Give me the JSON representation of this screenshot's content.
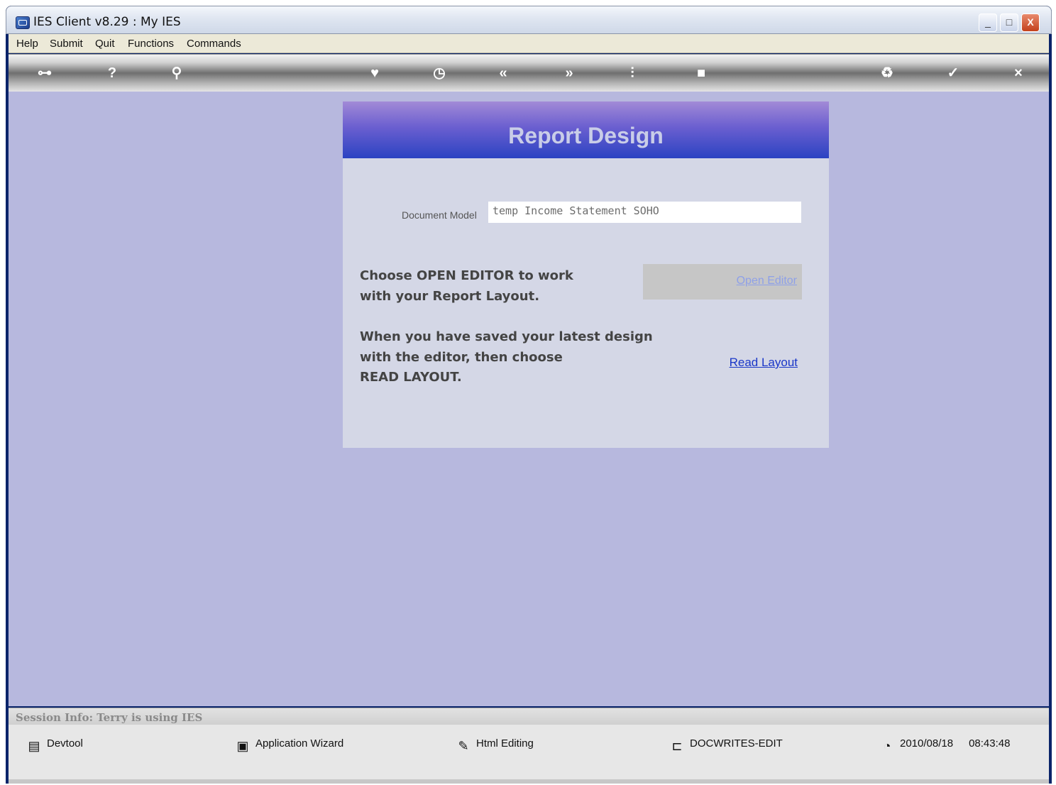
{
  "window": {
    "title": "IES Client v8.29 : My IES",
    "controls": {
      "minimize": "_",
      "maximize": "□",
      "close": "X"
    }
  },
  "menu": {
    "items": [
      "Help",
      "Submit",
      "Quit",
      "Functions",
      "Commands"
    ]
  },
  "toolbar": {
    "icons": [
      {
        "name": "key-icon",
        "glyph": "⊶"
      },
      {
        "name": "help-icon",
        "glyph": "?"
      },
      {
        "name": "search-icon",
        "glyph": "⚲"
      },
      {
        "name": "heart-icon",
        "glyph": "♥"
      },
      {
        "name": "clock-icon",
        "glyph": "◷"
      },
      {
        "name": "back-icon",
        "glyph": "«"
      },
      {
        "name": "forward-icon",
        "glyph": "»"
      },
      {
        "name": "tools-icon",
        "glyph": "⫶"
      },
      {
        "name": "stop-icon",
        "glyph": "■"
      },
      {
        "name": "recycle-icon",
        "glyph": "♻"
      },
      {
        "name": "check-icon",
        "glyph": "✓"
      },
      {
        "name": "close-icon",
        "glyph": "×"
      }
    ]
  },
  "panel": {
    "title": "Report Design",
    "document_model_label": "Document Model",
    "document_model_value": "temp Income Statement SOHO",
    "open_editor_text_1": "Choose OPEN EDITOR to work",
    "open_editor_text_2": "with your Report Layout.",
    "open_editor_link": "Open Editor",
    "read_layout_text_1": "When you have saved your latest design",
    "read_layout_text_2": "with the editor, then choose",
    "read_layout_text_3": "READ LAYOUT.",
    "read_layout_link": "Read Layout"
  },
  "session": {
    "info": "Session Info: Terry is using IES"
  },
  "status": {
    "devtool": "Devtool",
    "app_wizard": "Application Wizard",
    "html_editing": "Html Editing",
    "docwrites": "DOCWRITES-EDIT",
    "date": "2010/08/18",
    "time": "08:43:48"
  },
  "colors": {
    "main_bg": "#b7b8de",
    "panel_bg": "#d4d7e6",
    "header_gradient_top": "#a28ad6",
    "header_gradient_bottom": "#2b43c2",
    "link": "#1a37c8"
  }
}
